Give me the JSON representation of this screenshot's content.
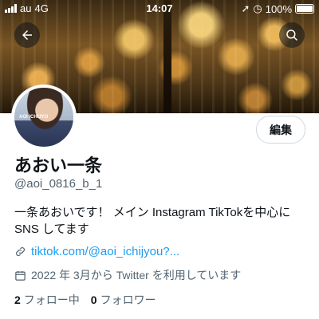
{
  "status_bar": {
    "carrier": "au",
    "network": "4G",
    "time": "14:07",
    "battery": "100%"
  },
  "profile": {
    "name": "あおい一条",
    "handle": "@aoi_0816_b_1",
    "bio_line1": "一条あおいです！ メイン Instagram TikTokを中心に",
    "bio_line2": "SNS してます",
    "link": "tiktok.com/@aoi_ichijyou?...",
    "joined": "2022 年 3月から Twitter を利用しています",
    "following_count": "2",
    "following_label": "フォロー中",
    "followers_count": "0",
    "followers_label": "フォロワー",
    "avatar_tag": "AOI ICHIJYO"
  },
  "buttons": {
    "edit_label": "編集"
  },
  "icons": {
    "back": "back-arrow-icon",
    "search": "search-icon",
    "link": "link-icon",
    "calendar": "calendar-icon"
  }
}
